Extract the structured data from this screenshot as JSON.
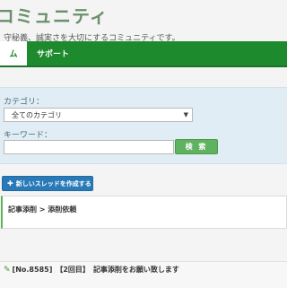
{
  "header": {
    "site_title": "コミュニティ",
    "tagline": "守秘義、誠実さを大切にするコミュニティです。"
  },
  "nav": {
    "tabs": [
      {
        "label": "ム",
        "active": true
      },
      {
        "label": "サポート",
        "active": false
      }
    ]
  },
  "search": {
    "category_label": "カテゴリ：",
    "category_value": "全てのカテゴリ",
    "keyword_label": "キーワード：",
    "keyword_value": "",
    "search_button_label": "検 索"
  },
  "actions": {
    "new_thread_label": "新しいスレッドを作成する",
    "new_thread_icon": "plus-icon"
  },
  "breadcrumb": {
    "text": "記事添削 > 添削依頼"
  },
  "thread": {
    "icon": "pencil-icon",
    "id": "[No.8585]",
    "round": "【2回目】",
    "title": "記事添削をお願い致します"
  },
  "colors": {
    "nav_green": "#1e8a2e",
    "search_panel": "#e1edf4",
    "search_button": "#5fb25f",
    "new_thread_button": "#2a7ab8"
  }
}
